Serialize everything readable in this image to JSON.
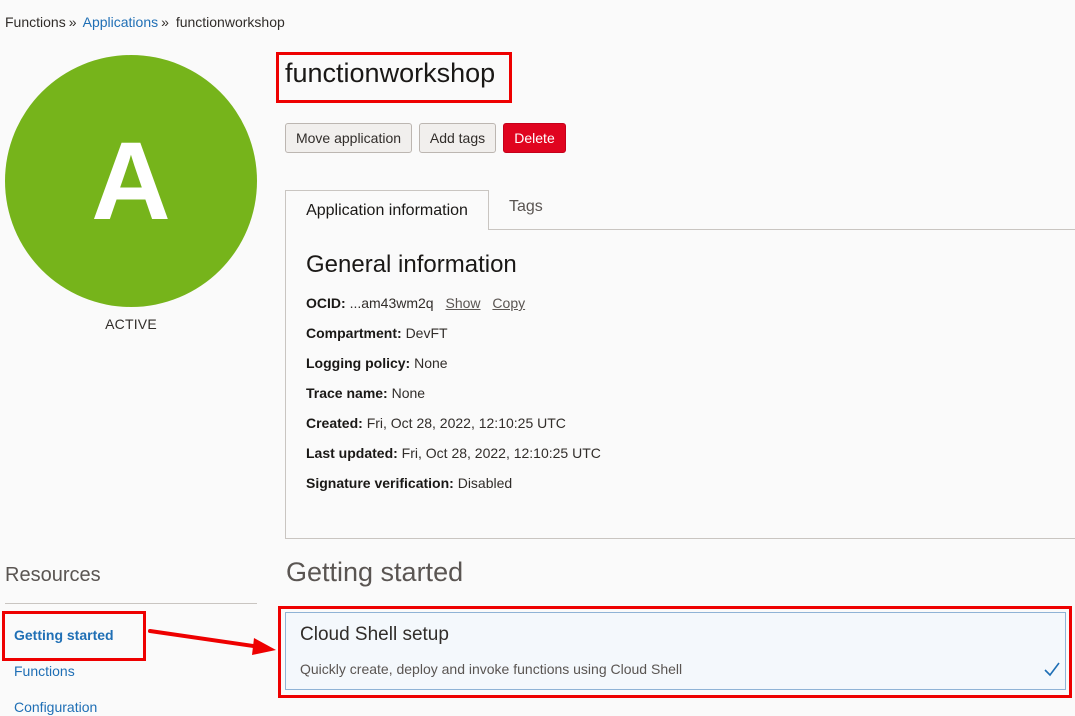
{
  "breadcrumb": {
    "root": "Functions",
    "separator": "»",
    "applications": "Applications",
    "current": "functionworkshop"
  },
  "application": {
    "avatar_letter": "A",
    "avatar_color": "#76b41b",
    "state": "ACTIVE",
    "name": "functionworkshop"
  },
  "actions": {
    "move": "Move application",
    "add_tags": "Add tags",
    "delete": "Delete"
  },
  "tabs": {
    "info": "Application information",
    "tags": "Tags"
  },
  "general": {
    "title": "General information",
    "ocid_label": "OCID:",
    "ocid_value": "...am43wm2q",
    "show": "Show",
    "copy": "Copy",
    "compartment_label": "Compartment:",
    "compartment_value": "DevFT",
    "logging_label": "Logging policy:",
    "logging_value": "None",
    "trace_label": "Trace name:",
    "trace_value": "None",
    "created_label": "Created:",
    "created_value": "Fri, Oct 28, 2022, 12:10:25 UTC",
    "updated_label": "Last updated:",
    "updated_value": "Fri, Oct 28, 2022, 12:10:25 UTC",
    "signature_label": "Signature verification:",
    "signature_value": "Disabled"
  },
  "resources": {
    "title": "Resources",
    "items": [
      "Getting started",
      "Functions",
      "Configuration"
    ]
  },
  "getting_started": {
    "title": "Getting started",
    "card_title": "Cloud Shell setup",
    "card_desc": "Quickly create, deploy and invoke functions using Cloud Shell"
  },
  "colors": {
    "accent_link": "#1f6fb5",
    "danger": "#e0041f",
    "highlight": "#ee0000"
  }
}
